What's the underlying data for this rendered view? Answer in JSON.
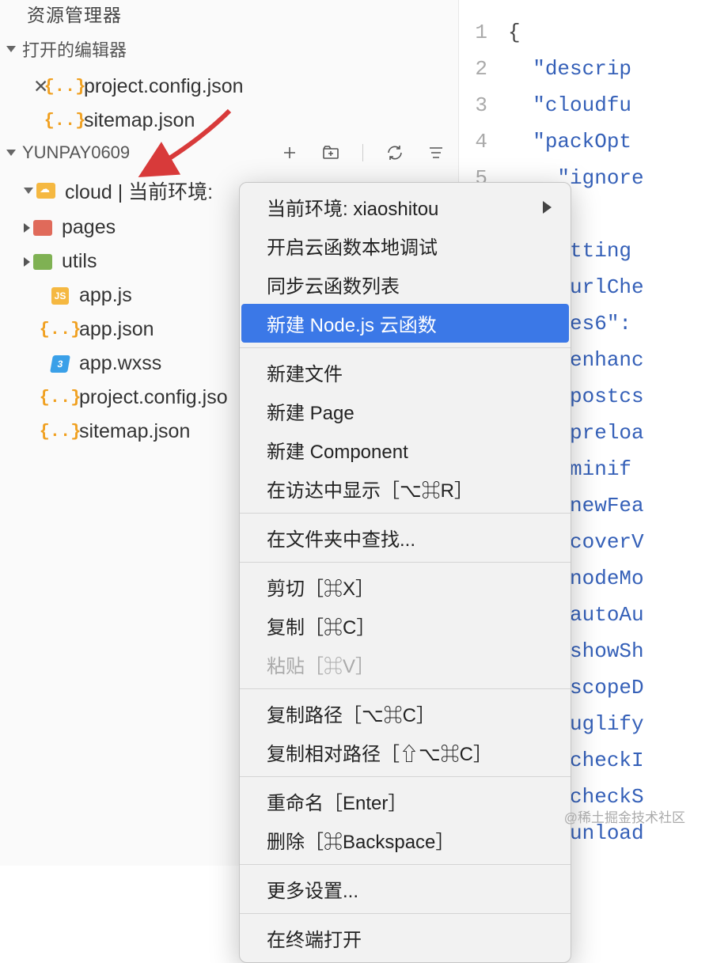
{
  "sidebar": {
    "title": "资源管理器",
    "open_editors_label": "打开的编辑器",
    "open_editors": [
      {
        "name": "project.config.json",
        "active": true
      },
      {
        "name": "sitemap.json",
        "active": false
      }
    ],
    "project_name": "YUNPAY0609",
    "tree": {
      "cloud_label": "cloud | 当前环境:",
      "pages_label": "pages",
      "utils_label": "utils",
      "files": [
        {
          "name": "app.js",
          "icon": "js"
        },
        {
          "name": "app.json",
          "icon": "json"
        },
        {
          "name": "app.wxss",
          "icon": "wxss"
        },
        {
          "name": "project.config.jso",
          "icon": "json"
        },
        {
          "name": "sitemap.json",
          "icon": "json"
        }
      ]
    }
  },
  "editor": {
    "lines": [
      {
        "n": 1,
        "pad": "",
        "t": "{"
      },
      {
        "n": 2,
        "pad": "  ",
        "k": "descrip"
      },
      {
        "n": 3,
        "pad": "  ",
        "k": "cloudfu"
      },
      {
        "n": 4,
        "pad": "  ",
        "k": "packOpt"
      },
      {
        "n": 5,
        "pad": "    ",
        "k": "ignore"
      },
      {
        "n": "",
        "pad": "  ",
        "t": "},"
      },
      {
        "n": "",
        "pad": "  ",
        "k": "setting"
      },
      {
        "n": "",
        "pad": "    ",
        "k": "urlChe"
      },
      {
        "n": "",
        "pad": "    ",
        "k": "es6\":"
      },
      {
        "n": "",
        "pad": "    ",
        "k": "enhanc"
      },
      {
        "n": "",
        "pad": "    ",
        "k": "postcs"
      },
      {
        "n": "",
        "pad": "    ",
        "k": "preloa"
      },
      {
        "n": "",
        "pad": "    ",
        "k": "minif"
      },
      {
        "n": "",
        "pad": "    ",
        "k": "newFea"
      },
      {
        "n": "",
        "pad": "    ",
        "k": "coverV"
      },
      {
        "n": "",
        "pad": "    ",
        "k": "nodeMo"
      },
      {
        "n": "",
        "pad": "    ",
        "k": "autoAu"
      },
      {
        "n": "",
        "pad": "    ",
        "k": "showSh"
      },
      {
        "n": "",
        "pad": "    ",
        "k": "scopeD"
      },
      {
        "n": "",
        "pad": "    ",
        "k": "uglify"
      },
      {
        "n": "",
        "pad": "    ",
        "k": "checkI"
      },
      {
        "n": "",
        "pad": "    ",
        "k": "checkS"
      },
      {
        "n": "",
        "pad": "    ",
        "k": "unload"
      }
    ]
  },
  "context_menu": {
    "groups": [
      [
        {
          "label": "当前环境: xiaoshitou",
          "submenu": true
        },
        {
          "label": "开启云函数本地调试"
        },
        {
          "label": "同步云函数列表"
        },
        {
          "label": "新建 Node.js 云函数",
          "highlight": true
        }
      ],
      [
        {
          "label": "新建文件"
        },
        {
          "label": "新建 Page"
        },
        {
          "label": "新建 Component"
        },
        {
          "label": "在访达中显示［⌥⌘R］"
        }
      ],
      [
        {
          "label": "在文件夹中查找..."
        }
      ],
      [
        {
          "label": "剪切［⌘X］"
        },
        {
          "label": "复制［⌘C］"
        },
        {
          "label": "粘贴［⌘V］",
          "disabled": true
        }
      ],
      [
        {
          "label": "复制路径［⌥⌘C］"
        },
        {
          "label": "复制相对路径［⇧⌥⌘C］"
        }
      ],
      [
        {
          "label": "重命名［Enter］"
        },
        {
          "label": "删除［⌘Backspace］"
        }
      ],
      [
        {
          "label": "更多设置..."
        }
      ],
      [
        {
          "label": "在终端打开"
        }
      ]
    ]
  },
  "watermark": "@稀土掘金技术社区"
}
